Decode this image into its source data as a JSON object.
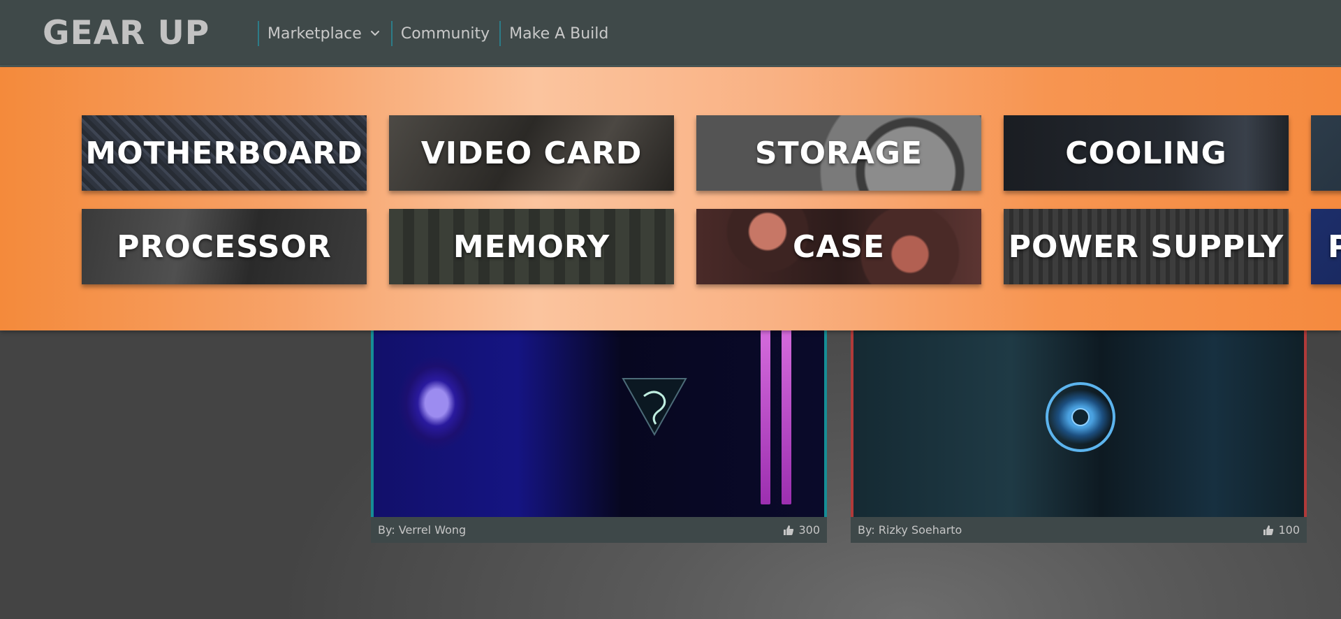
{
  "header": {
    "logo": "GEAR UP",
    "nav": [
      {
        "label": "Marketplace",
        "has_dropdown": true
      },
      {
        "label": "Community"
      },
      {
        "label": "Make A Build"
      }
    ]
  },
  "marketplace_menu": {
    "categories": [
      {
        "label": "MOTHERBOARD"
      },
      {
        "label": "VIDEO CARD"
      },
      {
        "label": "STORAGE"
      },
      {
        "label": "COOLING"
      },
      {
        "label": ""
      },
      {
        "label": "PROCESSOR"
      },
      {
        "label": "MEMORY"
      },
      {
        "label": "CASE"
      },
      {
        "label": "POWER SUPPLY"
      },
      {
        "label": "P"
      }
    ]
  },
  "builds": [
    {
      "author": "By: Verrel Wong",
      "likes": "300",
      "accent": "#168e96"
    },
    {
      "author": "By: Rizky Soeharto",
      "likes": "100",
      "accent": "#b03a3a"
    }
  ],
  "icons": {
    "nav_dropdown": "chevron-down-icon",
    "likes": "thumbs-up-icon"
  },
  "colors": {
    "header_bg": "#3f4949",
    "nav_divider": "#2c7c88",
    "menu_gradient_edge": "#f48a3b",
    "menu_gradient_center": "#fbc49e"
  }
}
